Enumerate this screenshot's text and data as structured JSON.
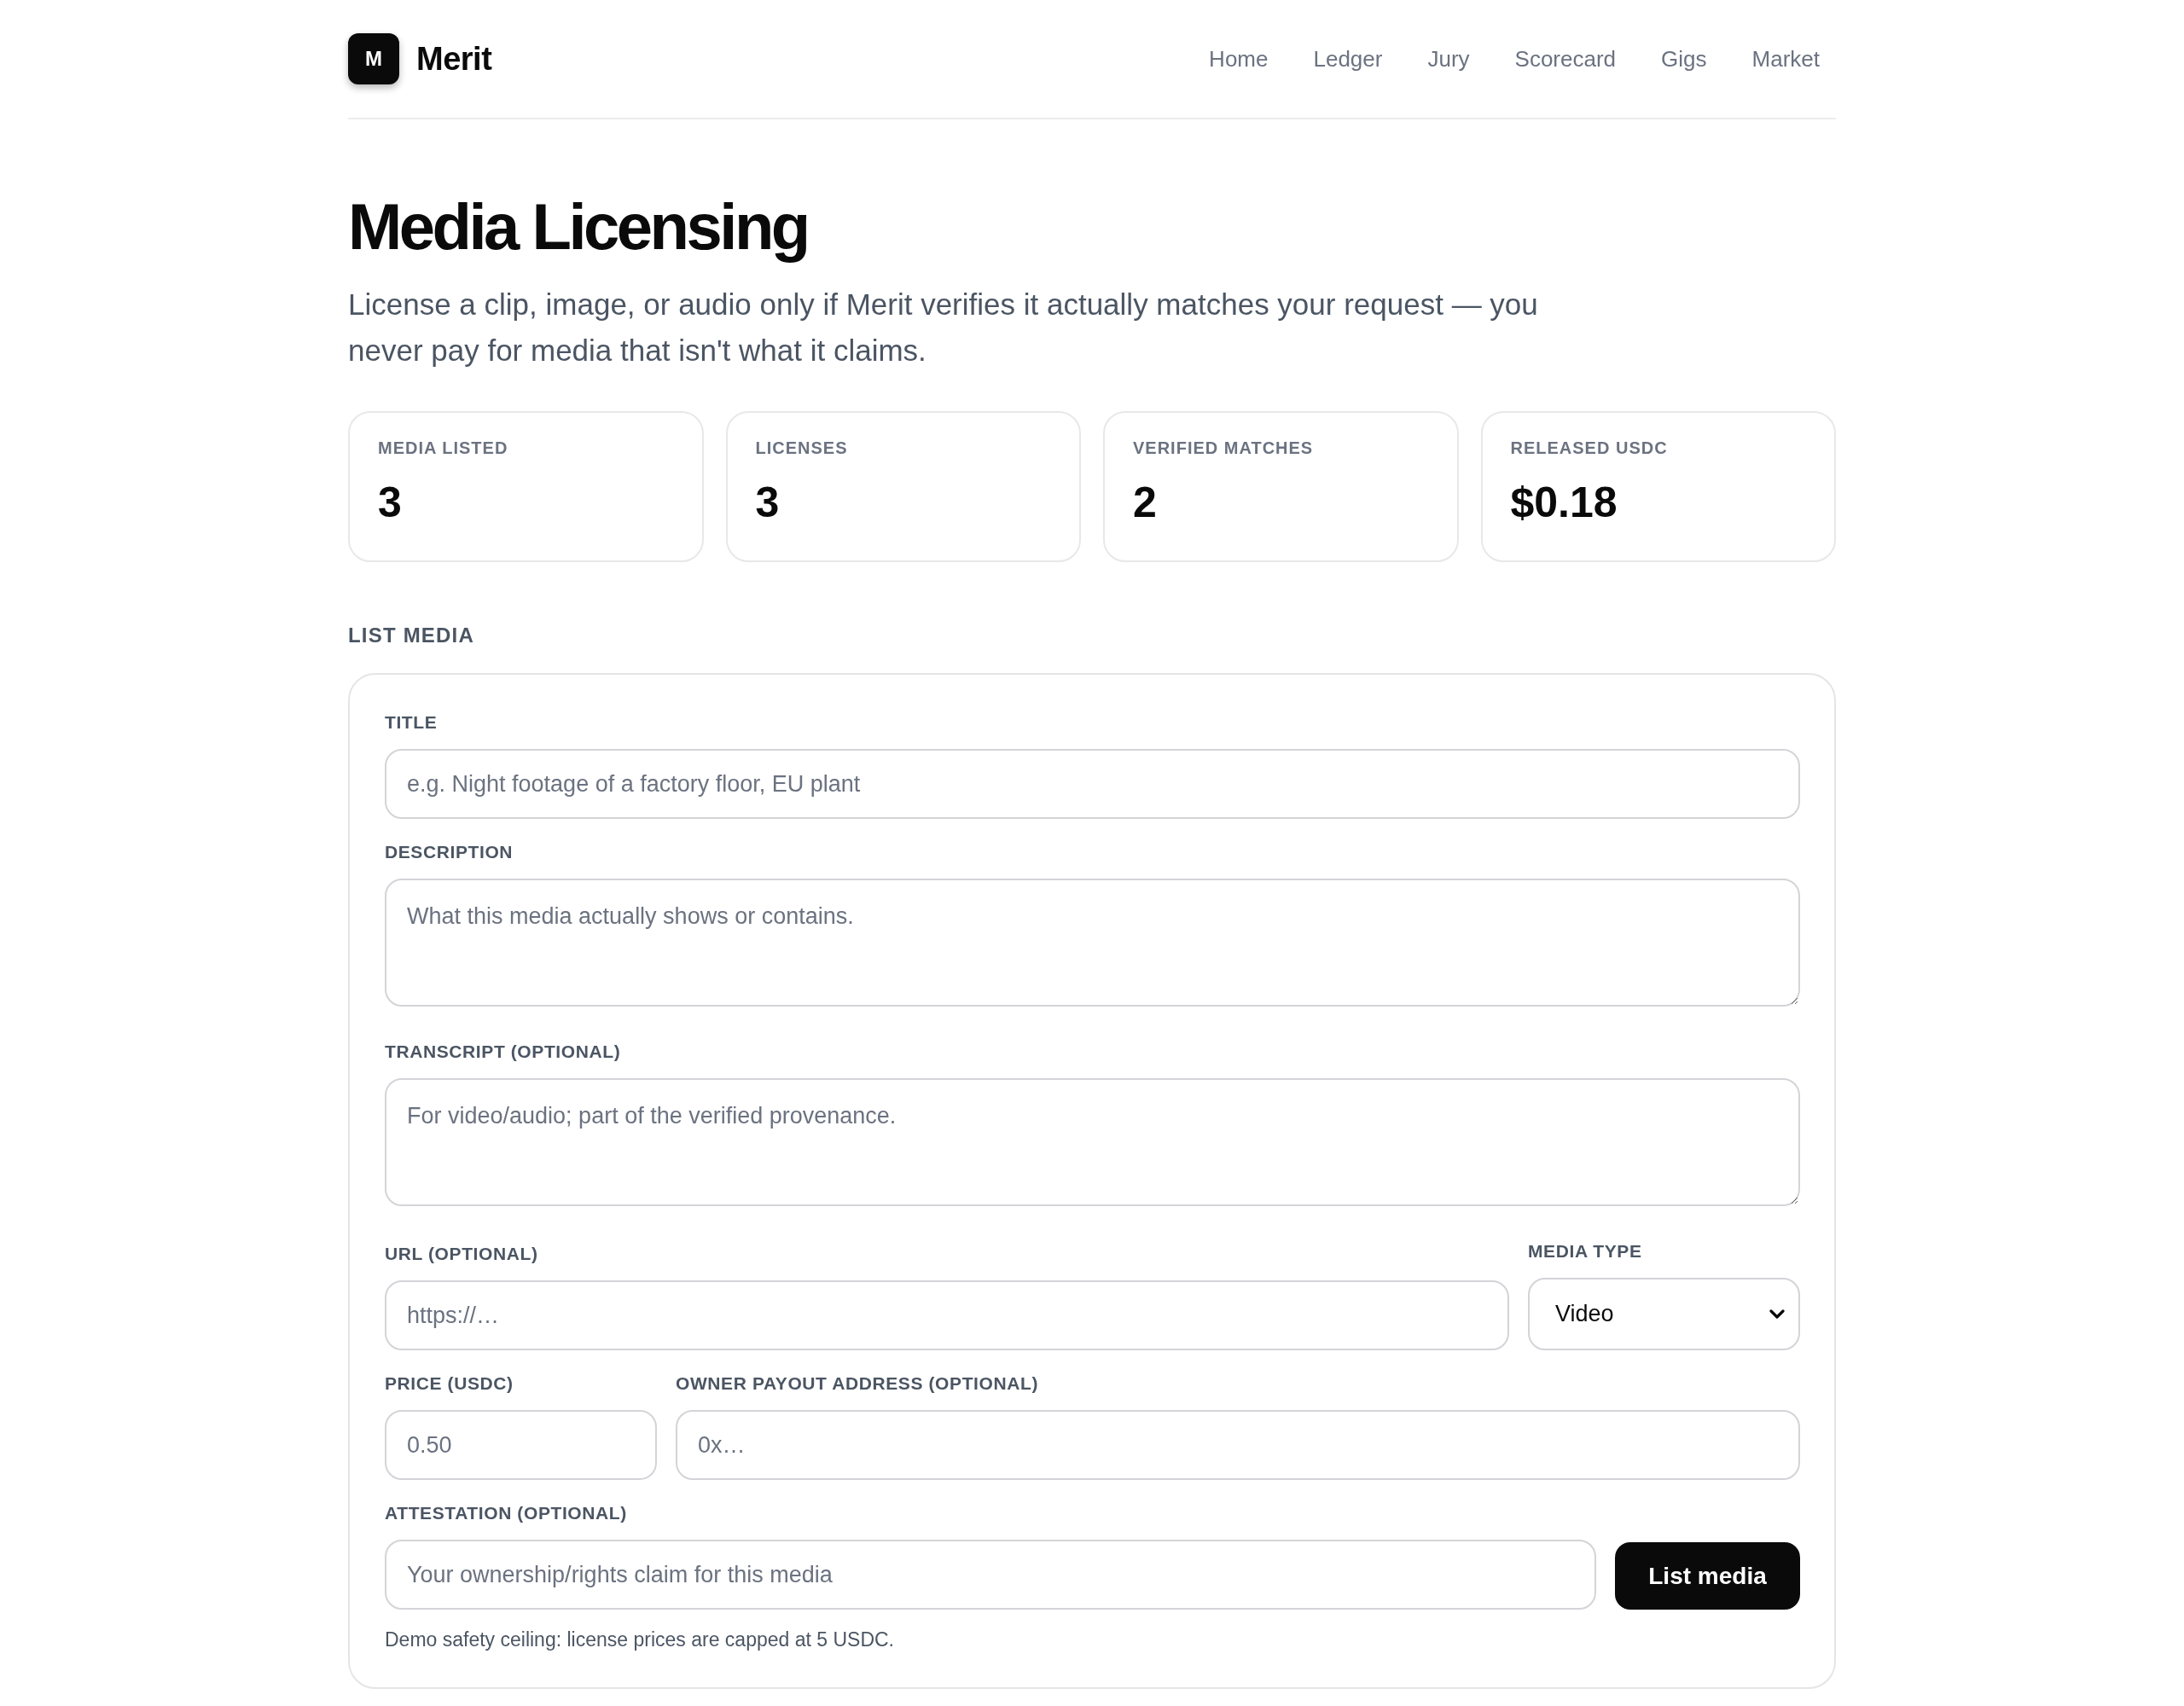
{
  "brand": {
    "logo": "M",
    "name": "Merit"
  },
  "nav": [
    "Home",
    "Ledger",
    "Jury",
    "Scorecard",
    "Gigs",
    "Market"
  ],
  "page": {
    "title": "Media Licensing",
    "subtitle": "License a clip, image, or audio only if Merit verifies it actually matches your request — you never pay for media that isn't what it claims."
  },
  "stats": [
    {
      "label": "MEDIA LISTED",
      "value": "3"
    },
    {
      "label": "LICENSES",
      "value": "3"
    },
    {
      "label": "VERIFIED MATCHES",
      "value": "2"
    },
    {
      "label": "RELEASED USDC",
      "value": "$0.18"
    }
  ],
  "list_media": {
    "heading": "LIST MEDIA",
    "rows": [
      [
        {
          "kind": "text",
          "label": "TITLE",
          "placeholder": "e.g. Night footage of a factory floor, EU plant"
        }
      ],
      [
        {
          "kind": "textarea",
          "label": "DESCRIPTION",
          "placeholder": "What this media actually shows or contains."
        }
      ],
      [
        {
          "kind": "textarea",
          "label": "TRANSCRIPT (OPTIONAL)",
          "placeholder": "For video/audio; part of the verified provenance."
        }
      ],
      [
        {
          "kind": "text",
          "label": "URL (OPTIONAL)",
          "placeholder": "https://…"
        },
        {
          "kind": "select",
          "label": "MEDIA TYPE",
          "value": "Video"
        }
      ],
      [
        {
          "kind": "number",
          "label": "PRICE (USDC)",
          "placeholder": "0.50"
        },
        {
          "kind": "text",
          "label": "OWNER PAYOUT ADDRESS (OPTIONAL)",
          "placeholder": "0x…"
        }
      ],
      [
        {
          "kind": "text",
          "label": "ATTESTATION (OPTIONAL)",
          "placeholder": "Your ownership/rights claim for this media"
        },
        {
          "kind": "button",
          "text": "List media"
        }
      ]
    ],
    "note": "Demo safety ceiling: license prices are capped at 5 USDC."
  }
}
